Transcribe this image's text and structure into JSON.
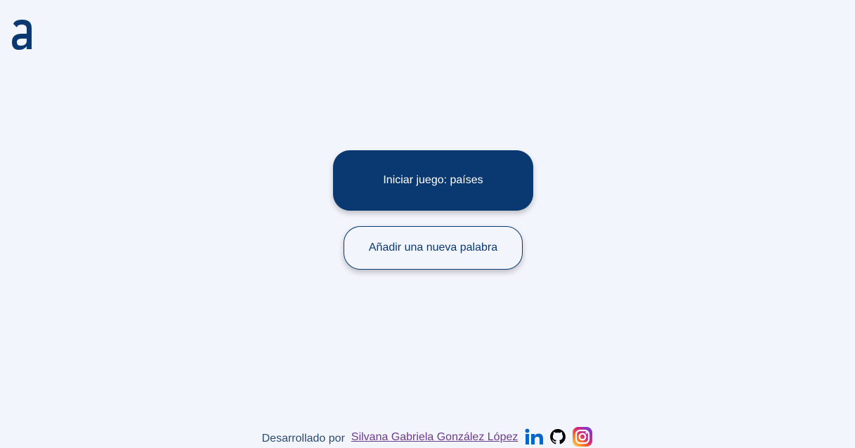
{
  "brand": {
    "logo_icon": "alura-a-logo-icon",
    "color": "#0A3871"
  },
  "actions": {
    "start_game_label": "Iniciar juego: países",
    "add_word_label": "Añadir una nueva palabra"
  },
  "footer": {
    "developed_by": "Desarrollado por",
    "author_name": "Silvana Gabriela González López",
    "socials": [
      {
        "icon": "linkedin-icon",
        "color": "#0A66C2"
      },
      {
        "icon": "github-icon",
        "color": "#000000"
      },
      {
        "icon": "instagram-icon",
        "color": "#E1306C"
      }
    ]
  },
  "colors": {
    "background": "#F3F5FC",
    "primary": "#0A3871",
    "link": "#6B3B8C"
  }
}
